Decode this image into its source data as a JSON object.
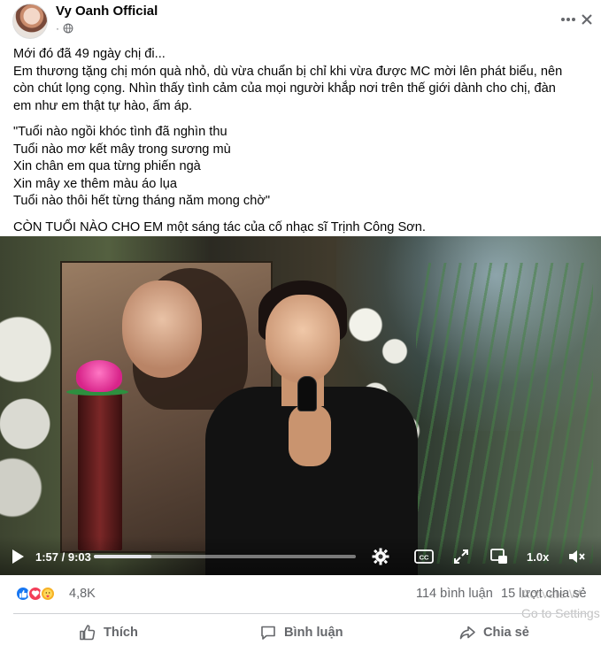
{
  "post": {
    "author": "Vy Oanh Official",
    "time_label": "·",
    "lines": [
      "Mới đó đã 49 ngày chị đi...",
      "Em thương tặng chị món quà nhỏ, dù vừa chuẩn bị chỉ khi vừa được MC mời lên phát biểu, nên",
      "còn chút lọng cọng. Nhìn thấy tình cảm của mọi người khắp nơi trên thế giới dành cho chị, đàn",
      "em như em thật tự hào, ấm áp."
    ],
    "quote": [
      "\"Tuổi nào ngồi khóc tình đã nghìn thu",
      "Tuổi nào mơ kết mây trong sương mù",
      "Xin chân em qua từng phiến ngà",
      "Xin mây xe thêm màu áo lụa",
      "Tuổi nào thôi hết từng tháng năm mong chờ\""
    ],
    "closing": "CÒN TUỔI NÀO CHO EM một sáng tác của cố nhạc sĩ Trịnh Công Sơn."
  },
  "video": {
    "time": "1:57 / 9:03",
    "progress": 0.22,
    "speed": "1.0x",
    "icons": [
      "play-icon",
      "settings-gear-icon",
      "captions-icon",
      "fullscreen-icon",
      "picture-in-picture-icon",
      "volume-icon"
    ]
  },
  "stats": {
    "reactions": [
      "like",
      "love",
      "care"
    ],
    "reaction_count": "4,8K",
    "comments": "114 bình luận",
    "shares": "15 lượt chia sẻ"
  },
  "watermark": {
    "line1": "Activate W",
    "line2": "Go to Settings"
  },
  "actions": {
    "like": "Thích",
    "comment": "Bình luận",
    "share": "Chia sẻ"
  },
  "colors": {
    "secondary_text": "#65676b",
    "like_blue": "#1877f2",
    "love_red": "#f33e58",
    "care_yellow": "#f7b125"
  }
}
